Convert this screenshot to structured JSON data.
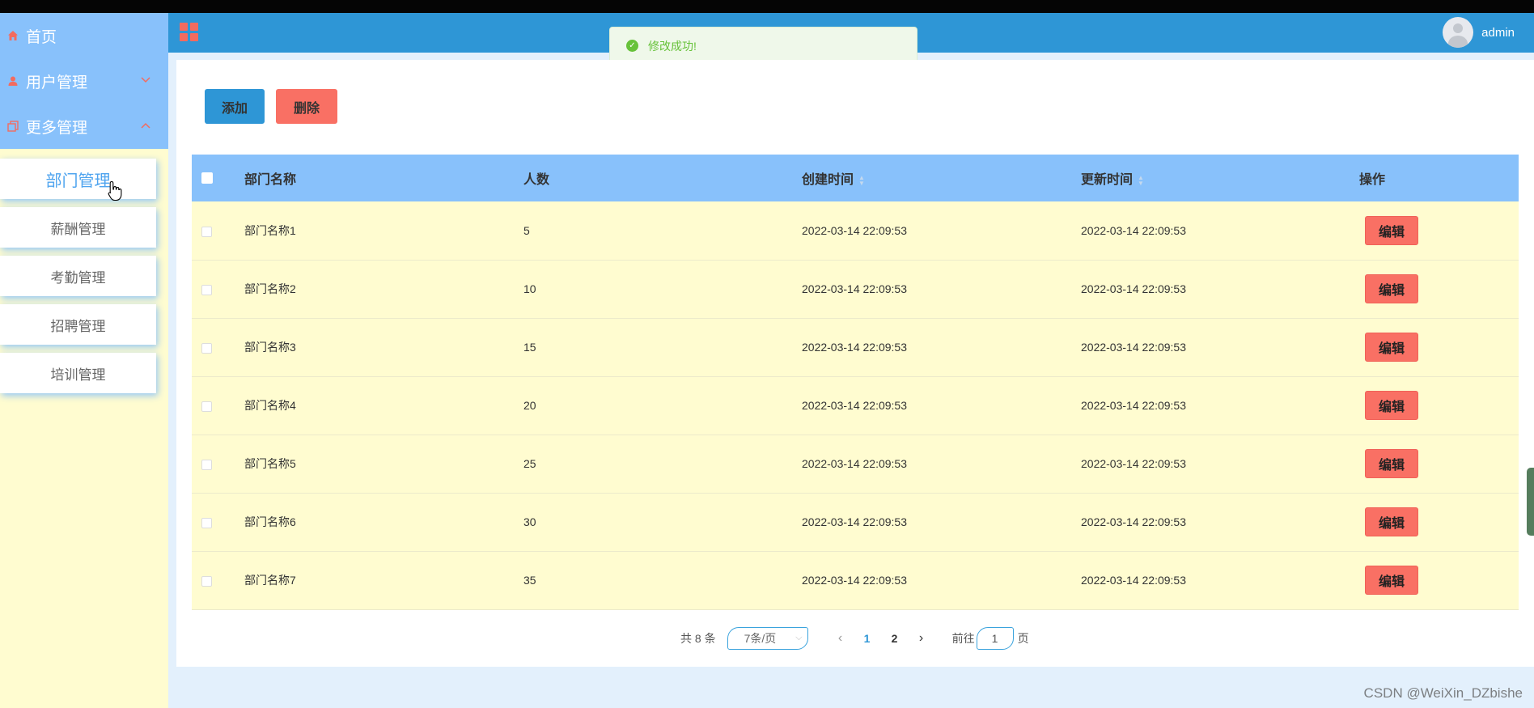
{
  "sidebar": {
    "menu": [
      {
        "label": "首页",
        "icon": "home-icon"
      },
      {
        "label": "用户管理",
        "icon": "user-icon",
        "chevron": "chevron-down-icon"
      },
      {
        "label": "更多管理",
        "icon": "copy-icon",
        "chevron": "chevron-up-icon"
      }
    ],
    "submenu": [
      {
        "label": "部门管理",
        "active": true
      },
      {
        "label": "薪酬管理"
      },
      {
        "label": "考勤管理"
      },
      {
        "label": "招聘管理"
      },
      {
        "label": "培训管理"
      }
    ]
  },
  "header": {
    "menu_icon": "grid-menu-icon",
    "username": "admin"
  },
  "toast": {
    "message": "修改成功!",
    "icon": "success-check-icon"
  },
  "toolbar": {
    "add_label": "添加",
    "delete_label": "删除"
  },
  "table": {
    "columns": [
      "部门名称",
      "人数",
      "创建时间",
      "更新时间",
      "操作"
    ],
    "edit_label": "编辑",
    "rows": [
      {
        "name": "部门名称1",
        "count": "5",
        "created": "2022-03-14 22:09:53",
        "updated": "2022-03-14 22:09:53"
      },
      {
        "name": "部门名称2",
        "count": "10",
        "created": "2022-03-14 22:09:53",
        "updated": "2022-03-14 22:09:53"
      },
      {
        "name": "部门名称3",
        "count": "15",
        "created": "2022-03-14 22:09:53",
        "updated": "2022-03-14 22:09:53"
      },
      {
        "name": "部门名称4",
        "count": "20",
        "created": "2022-03-14 22:09:53",
        "updated": "2022-03-14 22:09:53"
      },
      {
        "name": "部门名称5",
        "count": "25",
        "created": "2022-03-14 22:09:53",
        "updated": "2022-03-14 22:09:53"
      },
      {
        "name": "部门名称6",
        "count": "30",
        "created": "2022-03-14 22:09:53",
        "updated": "2022-03-14 22:09:53"
      },
      {
        "name": "部门名称7",
        "count": "35",
        "created": "2022-03-14 22:09:53",
        "updated": "2022-03-14 22:09:53"
      }
    ]
  },
  "pagination": {
    "total_text": "共 8 条",
    "page_size": "7条/页",
    "pages": [
      "1",
      "2"
    ],
    "current": "1",
    "goto_label": "前往",
    "goto_value": "1",
    "page_suffix": "页"
  },
  "watermark": "CSDN @WeiXin_DZbishe",
  "colors": {
    "header": "#2e96d6",
    "sidebar_menu": "#88c1fb",
    "sidebar_bg": "#fffcd0",
    "accent_red": "#f97064",
    "row_bg": "#fffcd0",
    "success": "#67c23a"
  }
}
